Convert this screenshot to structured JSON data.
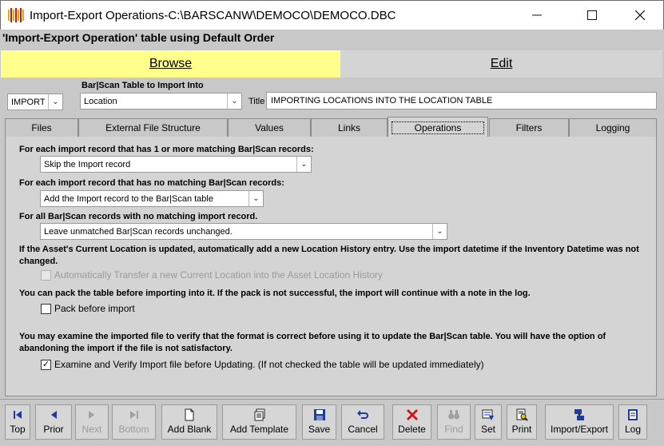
{
  "window": {
    "title": "Import-Export Operations-C:\\BARSCANW\\DEMOCO\\DEMOCO.DBC"
  },
  "header": {
    "text": "'Import-Export Operation' table using Default Order"
  },
  "view_tabs": {
    "browse": "Browse",
    "edit": "Edit"
  },
  "form": {
    "mode": "IMPORT",
    "table_label": "Bar|Scan Table to Import Into",
    "table_value": "Location",
    "title_label": "Title",
    "title_value": "IMPORTING LOCATIONS INTO THE LOCATION TABLE"
  },
  "tabs": [
    "Files",
    "External File Structure",
    "Values",
    "Links",
    "Operations",
    "Filters",
    "Logging"
  ],
  "active_tab": "Operations",
  "operations": {
    "matching_label": "For each import record that has 1 or more matching Bar|Scan records:",
    "matching_value": "Skip the Import record",
    "nomatch_label": "For each import record that has no matching Bar|Scan records:",
    "nomatch_value": "Add the Import record to the Bar|Scan table",
    "unmatched_label": "For all Bar|Scan records with no matching import record.",
    "unmatched_value": "Leave unmatched Bar|Scan records unchanged.",
    "history_text": "If the Asset's Current Location is updated, automatically add a new Location History entry. Use the import datetime if the Inventory Datetime was not changed.",
    "history_cb": "Automatically Transfer a new Current Location into the Asset Location History",
    "pack_text": "You can pack the table before importing into it. If the pack is not successful, the import will continue with a note in the log.",
    "pack_cb": "Pack before import",
    "verify_text": "You may examine the imported file to verify that the format is correct before using it to update the Bar|Scan table. You will have the option of abandoning the import if the file is not satisfactory.",
    "verify_cb": "Examine and Verify Import file before Updating. (If not checked the table will be updated immediately)"
  },
  "toolbar": {
    "top": "Top",
    "prior": "Prior",
    "next": "Next",
    "bottom": "Bottom",
    "add_blank": "Add Blank",
    "add_template": "Add Template",
    "save": "Save",
    "cancel": "Cancel",
    "delete": "Delete",
    "find": "Find",
    "set": "Set",
    "print": "Print",
    "import_export": "Import/Export",
    "log": "Log"
  },
  "colors": {
    "browse_tab": "#ffff8c",
    "accent_blue": "#1e3c9c",
    "delete_red": "#d01818"
  }
}
